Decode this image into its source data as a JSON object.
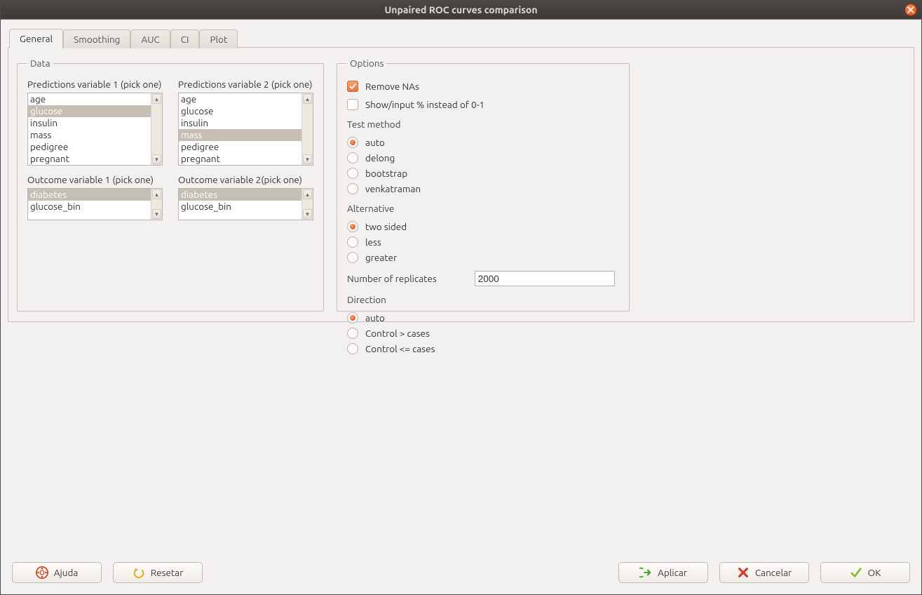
{
  "window": {
    "title": "Unpaired ROC curves comparison"
  },
  "tabs": {
    "general": "General",
    "smoothing": "Smoothing",
    "auc": "AUC",
    "ci": "CI",
    "plot": "Plot",
    "active": "general"
  },
  "data": {
    "legend": "Data",
    "pred1_label": "Predictions variable 1 (pick one)",
    "pred2_label": "Predictions variable 2 (pick one)",
    "out1_label": "Outcome variable 1 (pick one)",
    "out2_label": "Outcome variable 2(pick one)",
    "pred_items": [
      "age",
      "glucose",
      "insulin",
      "mass",
      "pedigree",
      "pregnant"
    ],
    "pred1_selected": "glucose",
    "pred2_selected": "mass",
    "out_items": [
      "diabetes",
      "glucose_bin"
    ],
    "out1_selected": "diabetes",
    "out2_selected": "diabetes"
  },
  "options": {
    "legend": "Options",
    "remove_nas_label": "Remove NAs",
    "remove_nas_checked": true,
    "show_percent_label": "Show/input % instead of 0-1",
    "show_percent_checked": false,
    "test_method_label": "Test method",
    "test_method_items": [
      "auto",
      "delong",
      "bootstrap",
      "venkatraman"
    ],
    "test_method_selected": "auto",
    "alternative_label": "Alternative",
    "alternative_items": [
      "two sided",
      "less",
      "greater"
    ],
    "alternative_selected": "two sided",
    "replicates_label": "Number of replicates",
    "replicates_value": "2000",
    "direction_label": "Direction",
    "direction_items": [
      "auto",
      "Control > cases",
      "Control <= cases"
    ],
    "direction_selected": "auto"
  },
  "footer": {
    "help": "Ajuda",
    "reset": "Resetar",
    "apply": "Aplicar",
    "cancel": "Cancelar",
    "ok": "OK"
  }
}
